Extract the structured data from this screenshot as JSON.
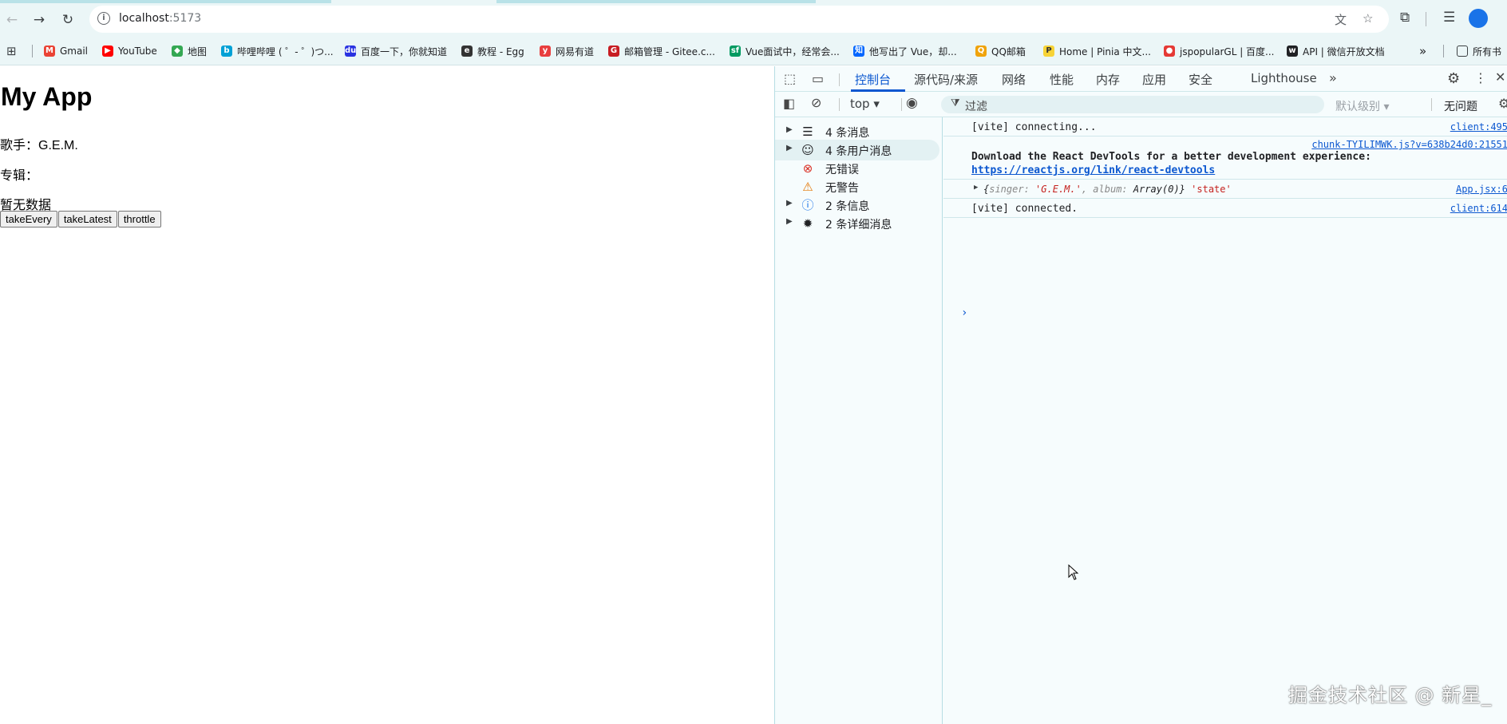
{
  "toolbar": {
    "url_host": "localhost",
    "url_port": ":5173"
  },
  "bookmarks": [
    {
      "label": "Gmail",
      "icon": "gmail-icon",
      "color": "#ea4335"
    },
    {
      "label": "YouTube",
      "icon": "youtube-icon",
      "color": "#ff0000"
    },
    {
      "label": "地图",
      "icon": "maps-icon",
      "color": "#34a853"
    },
    {
      "label": "哔哩哔哩 ( ゜- ゜)つ...",
      "icon": "bilibili-icon",
      "color": "#00a1d6"
    },
    {
      "label": "百度一下，你就知道",
      "icon": "baidu-icon",
      "color": "#2932e1"
    },
    {
      "label": "教程 - Egg",
      "icon": "egg-icon",
      "color": "#333333"
    },
    {
      "label": "网易有道",
      "icon": "youdao-icon",
      "color": "#e83e3e"
    },
    {
      "label": "邮箱管理 - Gitee.c...",
      "icon": "gitee-icon",
      "color": "#c71d23"
    },
    {
      "label": "Vue面试中，经常会...",
      "icon": "segmentfault-icon",
      "color": "#009a61"
    },
    {
      "label": "他写出了 Vue，却...",
      "icon": "zhihu-icon",
      "color": "#0066ff"
    },
    {
      "label": "QQ邮箱",
      "icon": "qqmail-icon",
      "color": "#f0a30a"
    },
    {
      "label": "Home | Pinia 中文...",
      "icon": "pinia-icon",
      "color": "#f7d336"
    },
    {
      "label": "jspopularGL | 百度...",
      "icon": "map-pin-icon",
      "color": "#e53935"
    },
    {
      "label": "API | 微信开放文档",
      "icon": "wechat-icon",
      "color": "#202124"
    }
  ],
  "bookmarks_overflow": "»",
  "bookmarks_all": "所有书",
  "page": {
    "title": "My App",
    "singer_line": "歌手：G.E.M.",
    "album_line": "专辑：",
    "empty_text": "暂无数据",
    "buttons": [
      "takeEvery",
      "takeLatest",
      "throttle"
    ]
  },
  "devtools": {
    "tabs": [
      "控制台",
      "源代码/来源",
      "网络",
      "性能",
      "内存",
      "应用",
      "安全",
      "Lighthouse"
    ],
    "active_tab": "控制台",
    "context": "top ▾",
    "filter_placeholder": "过滤",
    "levels": "默认级别 ▾",
    "issues": "无问题",
    "sidebar": [
      {
        "label": "4 条消息",
        "icon": "list-icon",
        "expandable": true,
        "selected": false
      },
      {
        "label": "4 条用户消息",
        "icon": "user-icon",
        "expandable": true,
        "selected": true
      },
      {
        "label": "无错误",
        "icon": "error-icon",
        "expandable": false,
        "selected": false
      },
      {
        "label": "无警告",
        "icon": "warning-icon",
        "expandable": false,
        "selected": false
      },
      {
        "label": "2 条信息",
        "icon": "info-icon",
        "expandable": true,
        "selected": false
      },
      {
        "label": "2 条详细消息",
        "icon": "bug-icon",
        "expandable": true,
        "selected": false
      }
    ],
    "logs": {
      "l1_msg": "[vite] connecting...",
      "l1_src": "client:495",
      "l2_src": "chunk-TYILIMWK.js?v=638b24d0:21551",
      "l2_msg": "Download the React DevTools for a better development experience:",
      "l2_link": "https://reactjs.org/link/react-devtools",
      "l3_src": "App.jsx:6",
      "l3_open": "{",
      "l3_k1": "singer",
      "l3_v1": "'G.E.M.'",
      "l3_k2": "album",
      "l3_v2": "Array(0)",
      "l3_close": "}",
      "l3_extra": "'state'",
      "l4_msg": "[vite] connected.",
      "l4_src": "client:614"
    }
  },
  "watermark": "掘金技术社区 @ 新星_"
}
